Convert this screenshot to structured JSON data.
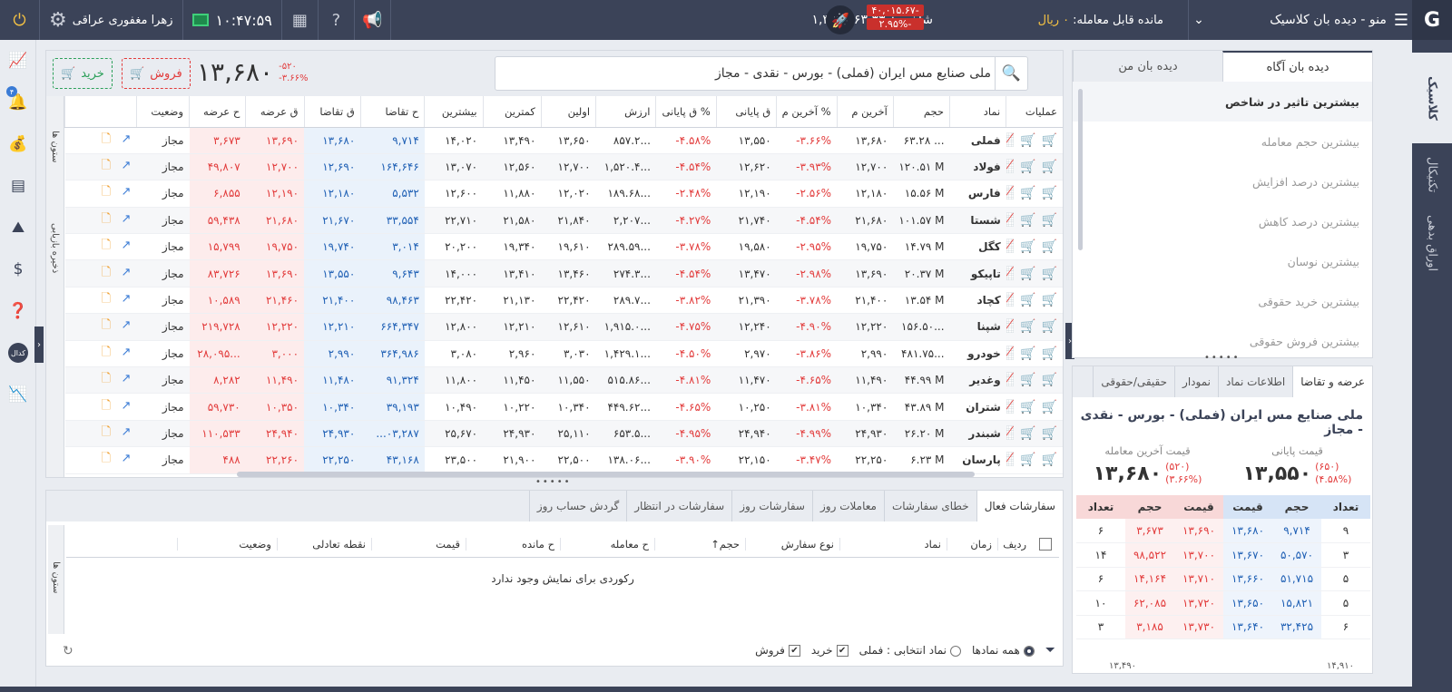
{
  "top": {
    "menu_title": "منو - دیده بان کلاسیک",
    "credit_label": "مانده قابل معامله:",
    "credit_value": "۰ ریال",
    "index_label": "شاخص:",
    "index_value": "۱,۳۵۶,۴۶۳.۳۳",
    "index_change": "-۴۰,۰۱۵.۶۷",
    "index_percent": "-۲.۹۵%",
    "user_name": "زهرا مغفوری عراقی",
    "clock": "۱۰:۴۷:۵۹"
  },
  "right_tabs": [
    "کلاسیک",
    "تکنیکال",
    "اوراق بدهی"
  ],
  "header": {
    "search_text": "ملی صنایع مس ایران (فملی) - بورس - نقدی - مجاز",
    "last_price": "۱۳,۶۸۰",
    "change": "-۵۲۰",
    "change_pct": "-۳.۶۶%",
    "sell_label": "فروش",
    "buy_label": "خرید"
  },
  "grid": {
    "side_label_1": "ستون ها",
    "side_label_2": "ذخیره بازیابی",
    "columns": [
      "عملیات",
      "نماد",
      "حجم",
      "آخرین م",
      "% آخرین م",
      "ق پایانی",
      "% ق پایانی",
      "ارزش",
      "اولین",
      "کمترین",
      "بیشترین",
      "ح تقاضا",
      "ق تقاضا",
      "ق عرضه",
      "ح عرضه",
      "وضعیت",
      ""
    ],
    "rows": [
      {
        "sym": "فملی",
        "vol": "۶۳.۲۸ ...",
        "last": "۱۳,۶۸۰",
        "lastp": "-۳.۶۶%",
        "close": "۱۳,۵۵۰",
        "closep": "-۴.۵۸%",
        "val": "۸۵۷.۲...",
        "first": "۱۳,۶۵۰",
        "low": "۱۳,۴۹۰",
        "high": "۱۴,۰۲۰",
        "bidv": "۹,۷۱۴",
        "bidp": "۱۳,۶۸۰",
        "askp": "۱۳,۶۹۰",
        "askv": "۳,۶۷۳",
        "st": "مجاز"
      },
      {
        "sym": "فولاد",
        "vol": "۱۲۰.۵۱ M",
        "last": "۱۲,۷۰۰",
        "lastp": "-۳.۹۳%",
        "close": "۱۲,۶۲۰",
        "closep": "-۴.۵۴%",
        "val": "۱,۵۲۰.۴...",
        "first": "۱۲,۷۰۰",
        "low": "۱۲,۵۶۰",
        "high": "۱۳,۰۷۰",
        "bidv": "۱۶۴,۶۴۶",
        "bidp": "۱۲,۶۹۰",
        "askp": "۱۲,۷۰۰",
        "askv": "۴۹,۸۰۷",
        "st": "مجاز"
      },
      {
        "sym": "فارس",
        "vol": "۱۵.۵۶ M",
        "last": "۱۲,۱۸۰",
        "lastp": "-۲.۵۶%",
        "close": "۱۲,۱۹۰",
        "closep": "-۲.۴۸%",
        "val": "۱۸۹.۶۸...",
        "first": "۱۲,۰۲۰",
        "low": "۱۱,۸۸۰",
        "high": "۱۲,۶۰۰",
        "bidv": "۵,۵۳۲",
        "bidp": "۱۲,۱۸۰",
        "askp": "۱۲,۱۹۰",
        "askv": "۶,۸۵۵",
        "st": "مجاز"
      },
      {
        "sym": "شستا",
        "vol": "۱۰۱.۵۷ M",
        "last": "۲۱,۶۸۰",
        "lastp": "-۴.۵۴%",
        "close": "۲۱,۷۴۰",
        "closep": "-۴.۲۷%",
        "val": "۲,۲۰۷...",
        "first": "۲۱,۸۴۰",
        "low": "۲۱,۵۸۰",
        "high": "۲۲,۷۱۰",
        "bidv": "۳۳,۵۵۴",
        "bidp": "۲۱,۶۷۰",
        "askp": "۲۱,۶۸۰",
        "askv": "۵۹,۴۳۸",
        "st": "مجاز"
      },
      {
        "sym": "کگل",
        "vol": "۱۴.۷۹ M",
        "last": "۱۹,۷۵۰",
        "lastp": "-۲.۹۵%",
        "close": "۱۹,۵۸۰",
        "closep": "-۳.۷۸%",
        "val": "۲۸۹.۵۹...",
        "first": "۱۹,۶۱۰",
        "low": "۱۹,۳۴۰",
        "high": "۲۰,۲۰۰",
        "bidv": "۳,۰۱۴",
        "bidp": "۱۹,۷۴۰",
        "askp": "۱۹,۷۵۰",
        "askv": "۱۵,۷۹۹",
        "st": "مجاز"
      },
      {
        "sym": "تاپیکو",
        "vol": "۲۰.۳۷ M",
        "last": "۱۳,۶۹۰",
        "lastp": "-۲.۹۸%",
        "close": "۱۳,۴۷۰",
        "closep": "-۴.۵۴%",
        "val": "۲۷۴.۳...",
        "first": "۱۳,۴۶۰",
        "low": "۱۳,۴۱۰",
        "high": "۱۴,۰۰۰",
        "bidv": "۹,۶۴۳",
        "bidp": "۱۳,۵۵۰",
        "askp": "۱۳,۶۹۰",
        "askv": "۸۳,۷۲۶",
        "st": "مجاز"
      },
      {
        "sym": "کچاد",
        "vol": "۱۳.۵۴ M",
        "last": "۲۱,۴۰۰",
        "lastp": "-۳.۷۸%",
        "close": "۲۱,۳۹۰",
        "closep": "-۳.۸۲%",
        "val": "۲۸۹.۷...",
        "first": "۲۲,۴۲۰",
        "low": "۲۱,۱۳۰",
        "high": "۲۲,۴۲۰",
        "bidv": "۹۸,۴۶۳",
        "bidp": "۲۱,۴۰۰",
        "askp": "۲۱,۴۶۰",
        "askv": "۱۰,۵۸۹",
        "st": "مجاز"
      },
      {
        "sym": "شپنا",
        "vol": "۱۵۶.۵۰...",
        "last": "۱۲,۲۲۰",
        "lastp": "-۴.۹۰%",
        "close": "۱۲,۲۴۰",
        "closep": "-۴.۷۵%",
        "val": "۱,۹۱۵.۰...",
        "first": "۱۲,۶۱۰",
        "low": "۱۲,۲۱۰",
        "high": "۱۲,۸۰۰",
        "bidv": "۶۶۴,۳۴۷",
        "bidp": "۱۲,۲۱۰",
        "askp": "۱۲,۲۲۰",
        "askv": "۲۱۹,۷۲۸",
        "st": "مجاز"
      },
      {
        "sym": "خودرو",
        "vol": "۴۸۱.۷۵...",
        "last": "۲,۹۹۰",
        "lastp": "-۳.۸۶%",
        "close": "۲,۹۷۰",
        "closep": "-۴.۵۰%",
        "val": "۱,۴۲۹.۱...",
        "first": "۳,۰۳۰",
        "low": "۲,۹۶۰",
        "high": "۳,۰۸۰",
        "bidv": "۳۶۴,۹۸۶",
        "bidp": "۲,۹۹۰",
        "askp": "۳,۰۰۰",
        "askv": "۲۸,۰۹۵...",
        "st": "مجاز"
      },
      {
        "sym": "وغدیر",
        "vol": "۴۴.۹۹ M",
        "last": "۱۱,۴۹۰",
        "lastp": "-۴.۶۵%",
        "close": "۱۱,۴۷۰",
        "closep": "-۴.۸۱%",
        "val": "۵۱۵.۸۶...",
        "first": "۱۱,۵۵۰",
        "low": "۱۱,۴۵۰",
        "high": "۱۱,۸۰۰",
        "bidv": "۹۱,۳۲۴",
        "bidp": "۱۱,۴۸۰",
        "askp": "۱۱,۴۹۰",
        "askv": "۸,۲۸۲",
        "st": "مجاز"
      },
      {
        "sym": "شتران",
        "vol": "۴۳.۸۹ M",
        "last": "۱۰,۳۴۰",
        "lastp": "-۳.۸۱%",
        "close": "۱۰,۲۵۰",
        "closep": "-۴.۶۵%",
        "val": "۴۴۹.۶۲...",
        "first": "۱۰,۳۴۰",
        "low": "۱۰,۲۲۰",
        "high": "۱۰,۴۹۰",
        "bidv": "۳۹,۱۹۳",
        "bidp": "۱۰,۳۴۰",
        "askp": "۱۰,۳۵۰",
        "askv": "۵۹,۷۳۰",
        "st": "مجاز"
      },
      {
        "sym": "شبندر",
        "vol": "۲۶.۲۰ M",
        "last": "۲۴,۹۳۰",
        "lastp": "-۴.۹۹%",
        "close": "۲۴,۹۴۰",
        "closep": "-۴.۹۵%",
        "val": "۶۵۳.۵...",
        "first": "۲۵,۱۱۰",
        "low": "۲۴,۹۳۰",
        "high": "۲۵,۶۷۰",
        "bidv": "...۰۳,۲۸۷",
        "bidp": "۲۴,۹۳۰",
        "askp": "۲۴,۹۴۰",
        "askv": "۱۱۰,۵۳۳",
        "st": "مجاز"
      },
      {
        "sym": "پارسان",
        "vol": "۶.۲۳ M",
        "last": "۲۲,۲۵۰",
        "lastp": "-۳.۴۷%",
        "close": "۲۲,۱۵۰",
        "closep": "-۳.۹۰%",
        "val": "۱۳۸.۰۶...",
        "first": "۲۲,۵۰۰",
        "low": "۲۱,۹۰۰",
        "high": "۲۳,۵۰۰",
        "bidv": "۴۳,۱۶۸",
        "bidp": "۲۲,۲۵۰",
        "askp": "۲۲,۲۶۰",
        "askv": "۴۸۸",
        "st": "مجاز"
      }
    ]
  },
  "orders": {
    "tabs": [
      "سفارشات فعال",
      "خطای سفارشات",
      "معاملات روز",
      "سفارشات روز",
      "سفارشات در انتظار",
      "گردش حساب روز"
    ],
    "columns": [
      "ردیف",
      "زمان",
      "نماد",
      "نوع سفارش",
      "حجم↑",
      "ح معامله",
      "ح مانده",
      "قیمت",
      "نقطه تعادلی",
      "وضعیت"
    ],
    "side_label": "ستون ها",
    "empty_text": "رکوردی برای نمایش وجود ندارد",
    "filter_all": "همه نمادها",
    "filter_selected": "نماد انتخابی : فملی",
    "filter_buy": "خرید",
    "filter_sell": "فروش"
  },
  "watch": {
    "tabs": [
      "دیده بان من",
      "دیده بان آگاه"
    ],
    "items": [
      "بیشترین تاثیر در شاخص",
      "بیشترین حجم معامله",
      "بیشترین درصد افزایش",
      "بیشترین درصد کاهش",
      "بیشترین نوسان",
      "بیشترین خرید حقوقی",
      "بیشترین فروش حقوقی"
    ]
  },
  "depth": {
    "tabs": [
      "عرضه و تقاضا",
      "اطلاعات نماد",
      "نمودار",
      "حقیقی/حقوقی"
    ],
    "title": "ملی صنایع مس ایران (فملی) - بورس - نقدی - مجاز",
    "close_label": "قیمت پایانی",
    "close_value": "۱۳,۵۵۰",
    "close_change": "(۶۵۰)",
    "close_pct": "(۴.۵۸%)",
    "last_label": "قیمت آخرین معامله",
    "last_value": "۱۳,۶۸۰",
    "last_change": "(۵۲۰)",
    "last_pct": "(۳.۶۶%)",
    "headers": [
      "تعداد",
      "حجم",
      "قیمت",
      "قیمت",
      "حجم",
      "تعداد"
    ],
    "rows": [
      [
        "۹",
        "۹,۷۱۴",
        "۱۳,۶۸۰",
        "۱۳,۶۹۰",
        "۳,۶۷۳",
        "۶"
      ],
      [
        "۳",
        "۵۰,۵۷۰",
        "۱۳,۶۷۰",
        "۱۳,۷۰۰",
        "۹۸,۵۲۲",
        "۱۴"
      ],
      [
        "۵",
        "۵۱,۷۱۵",
        "۱۳,۶۶۰",
        "۱۳,۷۱۰",
        "۱۴,۱۶۴",
        "۶"
      ],
      [
        "۵",
        "۱۵,۸۲۱",
        "۱۳,۶۵۰",
        "۱۳,۷۲۰",
        "۶۲,۰۸۵",
        "۱۰"
      ],
      [
        "۶",
        "۳۲,۴۲۵",
        "۱۳,۶۴۰",
        "۱۳,۷۳۰",
        "۳,۱۸۵",
        "۳"
      ]
    ],
    "range_low": "۱۳,۴۹۰",
    "range_high": "۱۴,۹۱۰"
  }
}
